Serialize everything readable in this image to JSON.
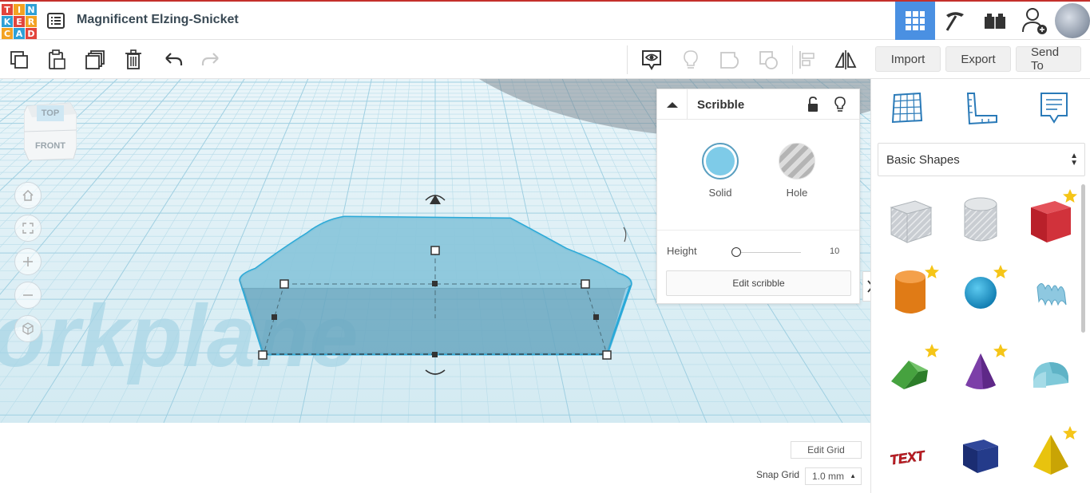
{
  "app": {
    "logo_letters": [
      "T",
      "I",
      "N",
      "K",
      "E",
      "R",
      "C",
      "A",
      "D"
    ],
    "logo_colors": [
      "#e2453c",
      "#f3a223",
      "#2ea0d6",
      "#2ea0d6",
      "#e2453c",
      "#f3a223",
      "#f3a223",
      "#2ea0d6",
      "#e2453c"
    ],
    "project_title": "Magnificent Elzing-Snicket"
  },
  "header": {
    "icons": [
      "grid-view-icon",
      "pickaxe-icon",
      "bricks-icon",
      "add-user-icon",
      "avatar"
    ]
  },
  "toolbar": {
    "tools": [
      "copy-icon",
      "paste-icon",
      "duplicate-icon",
      "delete-icon",
      "undo-icon",
      "redo-icon",
      "notes-visibility-icon",
      "light-bulb-icon",
      "group-icon",
      "ungroup-icon",
      "align-icon",
      "mirror-icon"
    ],
    "import_label": "Import",
    "export_label": "Export",
    "send_to_label": "Send To"
  },
  "workplane": {
    "watermark_text": "orkplane",
    "view_cube": {
      "top_label": "TOP",
      "front_label": "FRONT"
    },
    "nav_buttons": [
      "home-icon",
      "fit-view-icon",
      "zoom-in-icon",
      "zoom-out-icon",
      "perspective-icon"
    ]
  },
  "inspector": {
    "title": "Scribble",
    "solid_label": "Solid",
    "hole_label": "Hole",
    "solid_color": "#7ecbe8",
    "height_label": "Height",
    "height_value": "10",
    "edit_button_label": "Edit scribble"
  },
  "grid": {
    "edit_grid_label": "Edit Grid",
    "snap_label": "Snap Grid",
    "snap_value": "1.0 mm"
  },
  "right_panel": {
    "icons": [
      "workplane-icon",
      "ruler-icon",
      "notes-icon"
    ],
    "category": "Basic Shapes",
    "shapes": [
      {
        "name": "box-hole",
        "starred": false
      },
      {
        "name": "cylinder-hole",
        "starred": false
      },
      {
        "name": "box",
        "starred": true
      },
      {
        "name": "cylinder",
        "starred": true
      },
      {
        "name": "sphere",
        "starred": true
      },
      {
        "name": "scribble",
        "starred": false
      },
      {
        "name": "roof",
        "starred": true
      },
      {
        "name": "cone",
        "starred": true
      },
      {
        "name": "round-roof",
        "starred": false
      },
      {
        "name": "text",
        "starred": false
      },
      {
        "name": "wedge",
        "starred": false
      },
      {
        "name": "pyramid",
        "starred": true
      }
    ],
    "text_shape_label": "TEXT"
  }
}
